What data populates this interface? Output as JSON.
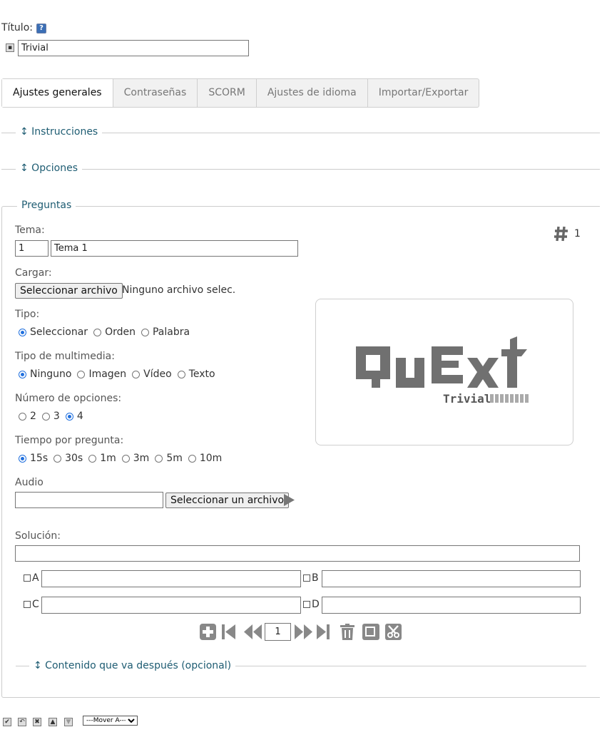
{
  "title_field": {
    "label": "Título:",
    "value": "Trivial"
  },
  "tabs": [
    {
      "label": "Ajustes generales",
      "active": true
    },
    {
      "label": "Contraseñas"
    },
    {
      "label": "SCORM"
    },
    {
      "label": "Ajustes de idioma"
    },
    {
      "label": "Importar/Exportar"
    }
  ],
  "sections": {
    "instrucciones": "↕ Instrucciones",
    "opciones": "↕ Opciones",
    "preguntas": "Preguntas",
    "contenido_despues": "↕ Contenido que va después (opcional)"
  },
  "question_counter": {
    "icon": "hash-icon",
    "value": "1"
  },
  "tema": {
    "label": "Tema:",
    "number": "1",
    "name": "Tema 1"
  },
  "cargar": {
    "label": "Cargar:",
    "button": "Seleccionar archivo",
    "status": "Ninguno archivo selec."
  },
  "tipo": {
    "label": "Tipo:",
    "options": [
      "Seleccionar",
      "Orden",
      "Palabra"
    ],
    "selected": 0
  },
  "tipo_multimedia": {
    "label": "Tipo de multimedia:",
    "options": [
      "Ninguno",
      "Imagen",
      "Vídeo",
      "Texto"
    ],
    "selected": 0
  },
  "numero_opciones": {
    "label": "Número de opciones:",
    "options": [
      "2",
      "3",
      "4"
    ],
    "selected": 2
  },
  "tiempo": {
    "label": "Tiempo por pregunta:",
    "options": [
      "15s",
      "30s",
      "1m",
      "3m",
      "5m",
      "10m"
    ],
    "selected": 0
  },
  "audio": {
    "label": "Audio",
    "value": "",
    "button": "Seleccionar un archivo"
  },
  "solucion": {
    "label": "Solución:",
    "value": ""
  },
  "answers": [
    {
      "letter": "A",
      "value": ""
    },
    {
      "letter": "B",
      "value": ""
    },
    {
      "letter": "C",
      "value": ""
    },
    {
      "letter": "D",
      "value": ""
    }
  ],
  "navigation": {
    "page": "1"
  },
  "logo": {
    "main": "QuExt",
    "sub": "Trivial"
  },
  "bottom_toolbar": {
    "move_select": "---Mover A---"
  },
  "colors": {
    "accent": "#1e5c72",
    "radio": "#1f6fde",
    "icon_grey": "#888888"
  }
}
